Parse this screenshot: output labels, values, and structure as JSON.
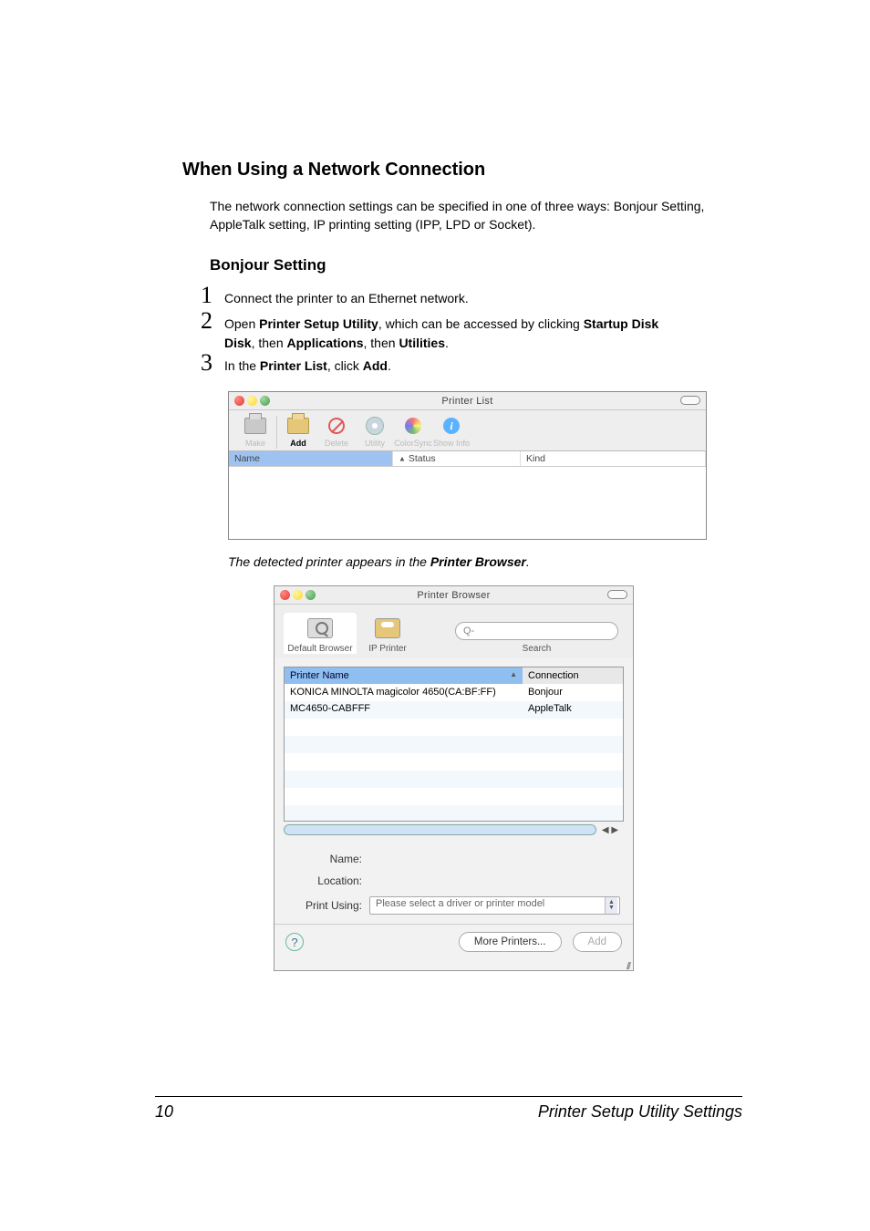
{
  "section": {
    "h1": "When Using a Network Connection",
    "intro": "The network connection settings can be specified in one of three ways: Bonjour Setting, AppleTalk setting, IP printing setting (IPP, LPD or Socket).",
    "h2": "Bonjour Setting"
  },
  "steps": {
    "n1": "1",
    "t1": "Connect the printer to an Ethernet network.",
    "n2": "2",
    "t2_a": "Open ",
    "t2_b": "Printer Setup Utility",
    "t2_c": ", which can be accessed by clicking ",
    "t2_d": "Startup Disk",
    "t2_e": ", then ",
    "t2_f": "Applications",
    "t2_g": ", then ",
    "t2_h": "Utilities",
    "t2_i": ".",
    "n3": "3",
    "t3_a": "In the ",
    "t3_b": "Printer List",
    "t3_c": ", click ",
    "t3_d": "Add",
    "t3_e": "."
  },
  "note": {
    "a": "The detected printer appears in the ",
    "b": "Printer Browser",
    "c": "."
  },
  "fig1": {
    "title": "Printer List",
    "toolbar": {
      "makeDefault": "Make Default",
      "add": "Add",
      "delete": "Delete",
      "utility": "Utility",
      "colorsync": "ColorSync",
      "showinfo": "Show Info"
    },
    "cols": {
      "name": "Name",
      "status": "Status",
      "kind": "Kind"
    }
  },
  "fig2": {
    "title": "Printer Browser",
    "tabs": {
      "default": "Default Browser",
      "ip": "IP Printer"
    },
    "search_label": "Search",
    "search_prefix": "Q-",
    "cols": {
      "pn": "Printer Name",
      "cn": "Connection"
    },
    "rows": [
      {
        "pn": "KONICA MINOLTA magicolor 4650(CA:BF:FF)",
        "cn": "Bonjour"
      },
      {
        "pn": "MC4650-CABFFF",
        "cn": "AppleTalk"
      }
    ],
    "form": {
      "name": "Name:",
      "location": "Location:",
      "printusing": "Print Using:",
      "printusing_value": "Please select a driver or printer model"
    },
    "buttons": {
      "more": "More Printers...",
      "add": "Add",
      "help": "?"
    }
  },
  "footer": {
    "page": "10",
    "title": "Printer Setup Utility Settings"
  }
}
